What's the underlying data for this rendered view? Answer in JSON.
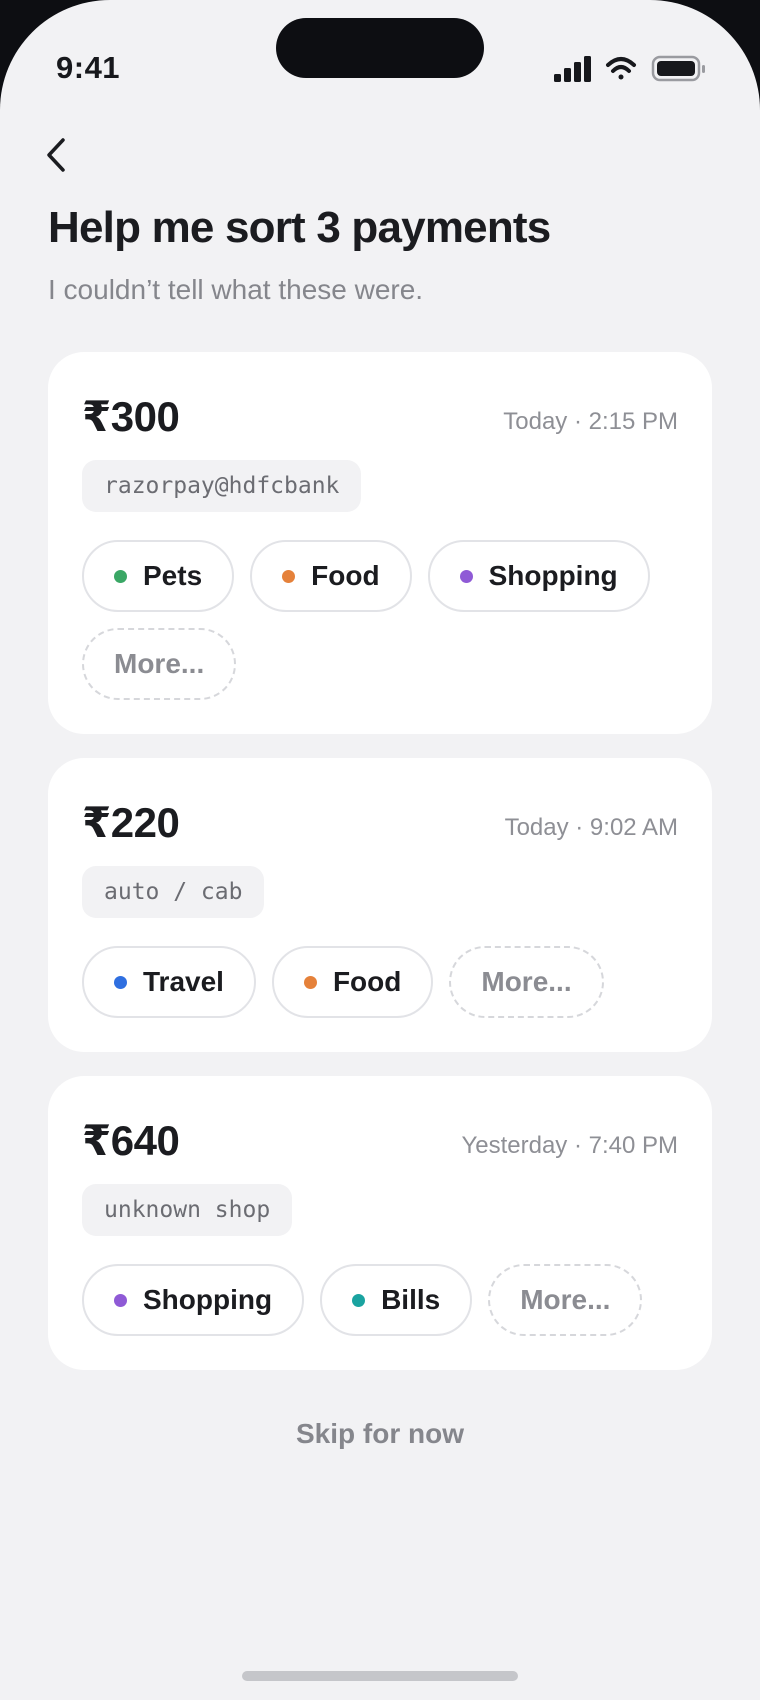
{
  "status_bar": {
    "time": "9:41",
    "icons": [
      "signal-icon",
      "wifi-icon",
      "battery-icon"
    ]
  },
  "header": {
    "back_icon": "chevron-left-icon",
    "title": "Help me sort 3 payments",
    "subtitle": "I couldn’t tell what these were."
  },
  "payments": [
    {
      "amount": "₹300",
      "time": "Today · 2:15 PM",
      "merchant": "razorpay@hdfcbank",
      "categories": [
        {
          "label": "Pets",
          "color": "#3aa765"
        },
        {
          "label": "Food",
          "color": "#e5813a"
        },
        {
          "label": "Shopping",
          "color": "#8f5ad6"
        }
      ],
      "more_label": "More..."
    },
    {
      "amount": "₹220",
      "time": "Today · 9:02 AM",
      "merchant": "auto / cab",
      "categories": [
        {
          "label": "Travel",
          "color": "#2f6fe0"
        },
        {
          "label": "Food",
          "color": "#e5813a"
        }
      ],
      "more_label": "More..."
    },
    {
      "amount": "₹640",
      "time": "Yesterday · 7:40 PM",
      "merchant": "unknown shop",
      "categories": [
        {
          "label": "Shopping",
          "color": "#8f5ad6"
        },
        {
          "label": "Bills",
          "color": "#1aa3a0"
        }
      ],
      "more_label": "More..."
    }
  ],
  "footer": {
    "skip_label": "Skip for now"
  }
}
